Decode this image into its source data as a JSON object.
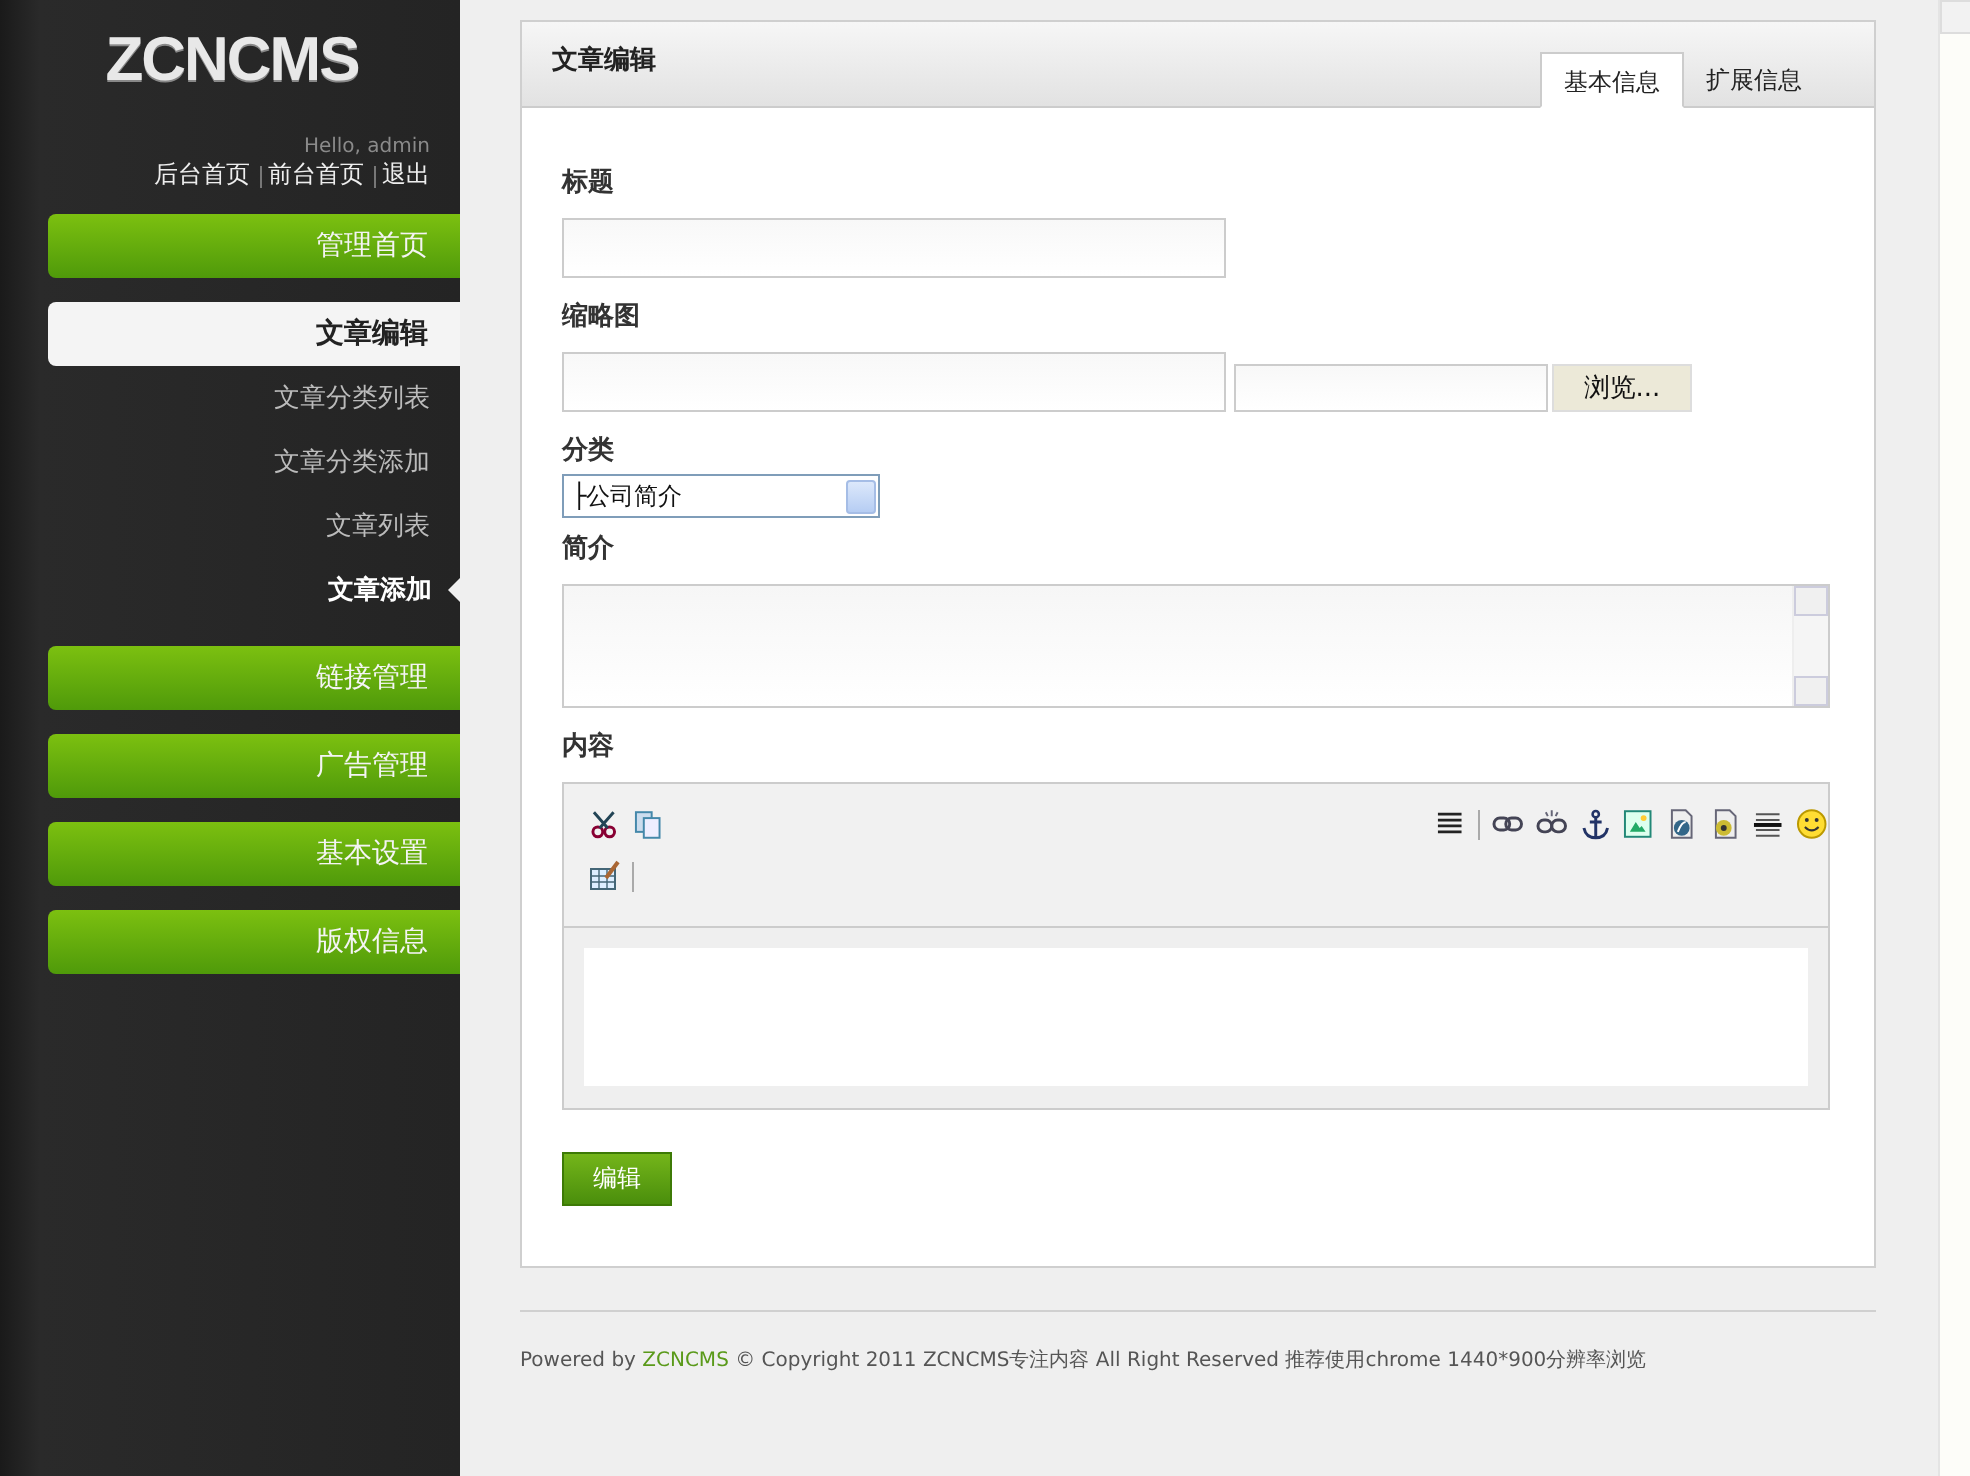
{
  "sidebar": {
    "logo": "ZCNCMS",
    "greeting": "Hello, admin",
    "top_links": [
      "后台首页",
      "前台首页",
      "退出"
    ],
    "menu": [
      {
        "label": "管理首页",
        "expanded": false
      },
      {
        "label": "文章编辑",
        "expanded": true,
        "children": [
          {
            "label": "文章分类列表",
            "selected": false
          },
          {
            "label": "文章分类添加",
            "selected": false
          },
          {
            "label": "文章列表",
            "selected": false
          },
          {
            "label": "文章添加",
            "selected": true
          }
        ]
      },
      {
        "label": "链接管理",
        "expanded": false
      },
      {
        "label": "广告管理",
        "expanded": false
      },
      {
        "label": "基本设置",
        "expanded": false
      },
      {
        "label": "版权信息",
        "expanded": false
      }
    ]
  },
  "panel": {
    "title": "文章编辑",
    "tabs": [
      {
        "label": "基本信息",
        "selected": true
      },
      {
        "label": "扩展信息",
        "selected": false
      }
    ],
    "fields": [
      {
        "kind": "text",
        "label": "标题"
      },
      {
        "kind": "file",
        "label": "缩略图",
        "button": "浏览..."
      },
      {
        "kind": "select",
        "label": "分类",
        "value": "├公司简介"
      },
      {
        "kind": "textarea",
        "label": "简介"
      },
      {
        "kind": "editor",
        "label": "内容"
      }
    ],
    "submit": "编辑"
  },
  "footer": {
    "before": "Powered by",
    "link": "ZCNCMS",
    "after": "© Copyright 2011 ZCNCMS专注内容  All Right Reserved 推荐使用chrome 1440*900分辨率浏览"
  }
}
